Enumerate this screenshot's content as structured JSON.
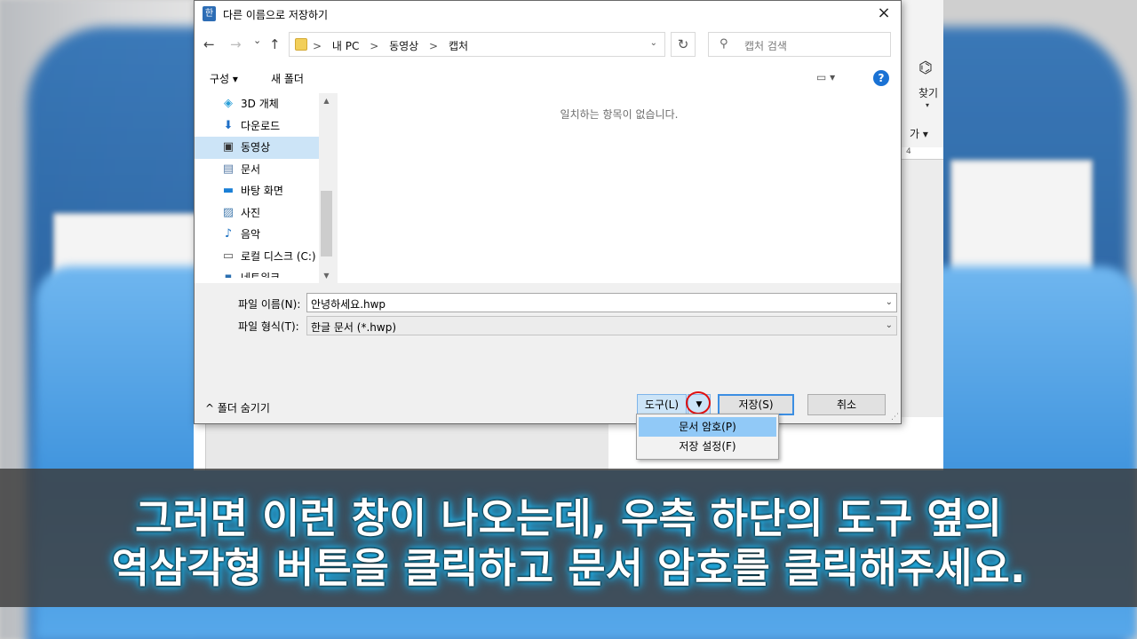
{
  "dialog": {
    "title": "다른 이름으로 저장하기",
    "app_icon": "한",
    "close_icon": "×",
    "nav": {
      "back": "←",
      "forward": "→",
      "recent": "⌄",
      "up": "↑"
    },
    "breadcrumb": [
      "내 PC",
      "동영상",
      "캡처"
    ],
    "breadcrumb_sep": ">",
    "refresh_icon": "↻",
    "search_placeholder": "캡처 검색",
    "toolbar": {
      "organize": "구성 ▾",
      "new_folder": "새 폴더",
      "view_icon": "▭ ▾",
      "help": "?"
    },
    "sidebar": [
      {
        "label": "3D 개체",
        "icon": "cube-icon",
        "glyph": "◈",
        "color": "#2a9fd8"
      },
      {
        "label": "다운로드",
        "icon": "download-icon",
        "glyph": "⬇",
        "color": "#1e6fc7"
      },
      {
        "label": "동영상",
        "icon": "video-icon",
        "glyph": "▣",
        "color": "#333333",
        "selected": true
      },
      {
        "label": "문서",
        "icon": "document-icon",
        "glyph": "▤",
        "color": "#5a7ea8"
      },
      {
        "label": "바탕 화면",
        "icon": "desktop-icon",
        "glyph": "▬",
        "color": "#1a7fd6"
      },
      {
        "label": "사진",
        "icon": "picture-icon",
        "glyph": "▨",
        "color": "#4a7fb0"
      },
      {
        "label": "음악",
        "icon": "music-icon",
        "glyph": "♪",
        "color": "#1a6fc0"
      },
      {
        "label": "로컬 디스크 (C:)",
        "icon": "disk-icon",
        "glyph": "▭",
        "color": "#555555"
      },
      {
        "label": "네트워크",
        "icon": "network-icon",
        "glyph": "▪",
        "color": "#2a6fb0"
      }
    ],
    "empty_message": "일치하는 항목이 없습니다.",
    "filename_label": "파일 이름(N):",
    "filename_value": "안녕하세요.hwp",
    "filetype_label": "파일 형식(T):",
    "filetype_value": "한글 문서 (*.hwp)",
    "dropdown_arrow": "⌄",
    "hide_folders": "^ 폴더 숨기기",
    "buttons": {
      "tools": "도구(L)",
      "tools_dd": "▼",
      "save": "저장(S)",
      "cancel": "취소"
    },
    "tools_menu": [
      "문서 암호(P)",
      "저장 설정(F)"
    ],
    "tools_menu_active": 0
  },
  "editor": {
    "find_label": "찾기",
    "find_arrow": "▾",
    "font_btn": "가 ▾",
    "ruler_mark": "4"
  },
  "caption": {
    "line1": "그러면 이런 창이 나오는데, 우측 하단의 도구 옆의",
    "line2": "역삼각형 버튼을 클릭하고 문서 암호를 클릭해주세요."
  },
  "colors": {
    "accent": "#3c8ee2",
    "selection": "#cce4f7",
    "menu_active": "#91c9f7",
    "highlight_circle": "#e01010",
    "caption_glow": "#25c8ff"
  }
}
